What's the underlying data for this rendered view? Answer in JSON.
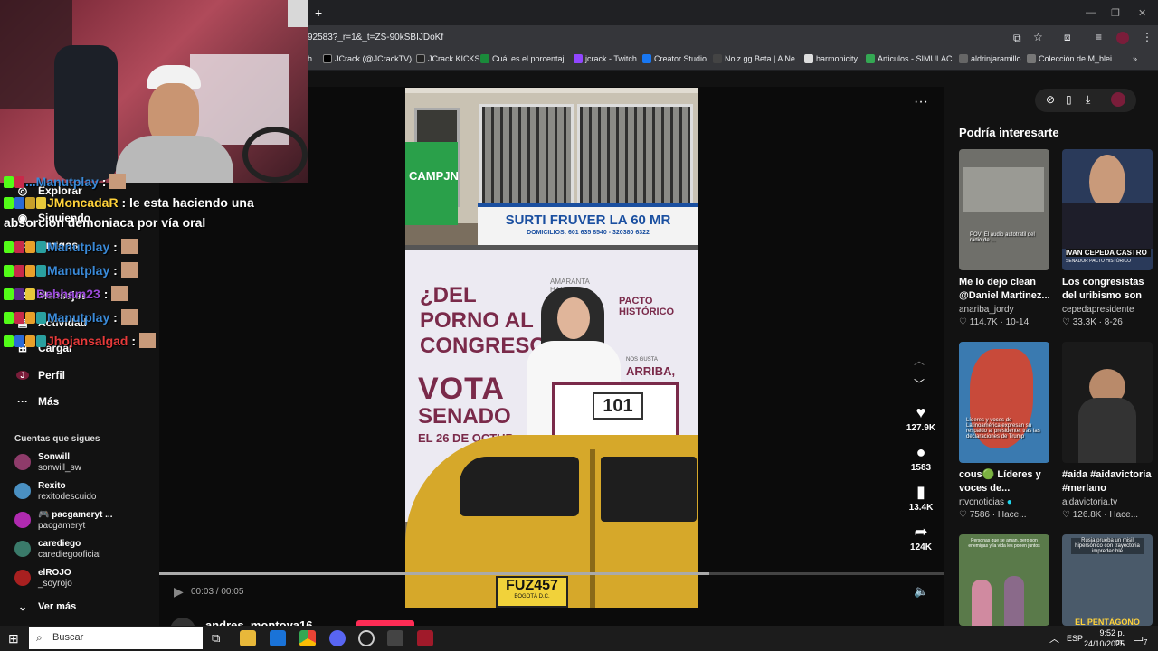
{
  "browser": {
    "url": "92583?_r=1&_t=ZS-90kSBIJDoKf",
    "new_tab": "+",
    "bookmarks": [
      "JCrack (@JCrackTV)...",
      "JCrack KICKS",
      "Cuál es el porcentaj...",
      "jcrack - Twitch",
      "Creator Studio",
      "Noiz.gg Beta | A Ne...",
      "harmonicity",
      "Articulos - SIMULAC...",
      "aldrinjaramillo",
      "Colección de M_blei..."
    ],
    "bookmark_colors": [
      "#000000",
      "#222222",
      "#1a8a3a",
      "#9146ff",
      "#1877f2",
      "#444444",
      "#555555",
      "#34a853",
      "#666666",
      "#777777"
    ]
  },
  "sidebar": {
    "nav": [
      {
        "label": "Explorar",
        "icon": "compass-icon"
      },
      {
        "label": "Siguiendo",
        "icon": "following-icon"
      },
      {
        "label": "Amigos",
        "icon": "friends-icon"
      },
      {
        "label": "Mensajes",
        "icon": "messages-icon"
      },
      {
        "label": "Actividad",
        "icon": "activity-icon"
      },
      {
        "label": "Cargar",
        "icon": "upload-icon"
      },
      {
        "label": "Perfil",
        "icon": "profile-icon"
      },
      {
        "label": "Más",
        "icon": "more-icon"
      }
    ],
    "following_title": "Cuentas que sigues",
    "following": [
      {
        "name": "Sonwill",
        "user": "sonwill_sw",
        "color": "#8e3b6a"
      },
      {
        "name": "Rexito",
        "user": "rexitodescuido",
        "color": "#4a90c2"
      },
      {
        "name": "pacgameryt ...",
        "user": "pacgameryt",
        "color": "#b02ab0"
      },
      {
        "name": "carediego",
        "user": "carediegooficial",
        "color": "#3a7a6a"
      },
      {
        "name": "elROJO",
        "user": "_soyrojo",
        "color": "#a82020"
      }
    ],
    "see_more": "Ver más"
  },
  "player": {
    "time": "00:03 / 00:05",
    "progress": 0.7,
    "author": "andres_montoya16",
    "video_text": {
      "shop_sign": "SURTI FRUVER LA 60 MR",
      "shop_phone": "DOMICILIOS: 601 635 8540 - 320380 6322",
      "poster_headline": "¿DEL PORNO AL CONGRESO?",
      "poster_name": "AMARANTA HANK",
      "party": "PACTO HISTÓRICO",
      "vote": "VOTA",
      "senate": "SENADO",
      "date": "EL 26 DE OCTUB",
      "arriba": "ARRIBA,",
      "nos_gusta": "NOS GUSTA",
      "number": "101",
      "plate": "FUZ457",
      "plate_city": "BOGOTÁ D.C.",
      "campana": "CAMPJN"
    },
    "actions": [
      {
        "icon": "heart-icon",
        "count": "127.9K"
      },
      {
        "icon": "comment-icon",
        "count": "1583"
      },
      {
        "icon": "bookmark-icon",
        "count": "13.4K"
      },
      {
        "icon": "share-icon",
        "count": "124K"
      }
    ]
  },
  "recommendations": {
    "title": "Podría interesarte",
    "items": [
      {
        "title": "Me lo dejo clean @Daniel Martinez...",
        "user": "anariba_jordy",
        "likes": "114.7K",
        "date": "10-14",
        "thumb_text": "POV: El audio autotratil del radio de ...",
        "bg": "#6f6f6a"
      },
      {
        "title": "Los congresistas del uribismo son unos...",
        "user": "cepedapresidente",
        "likes": "33.3K",
        "date": "8-26",
        "thumb_text": "IVAN CEPEDA CASTRO",
        "thumb_sub": "SENADOR PACTO HISTÓRICO",
        "bg": "#2a3a5a"
      },
      {
        "title": "cous🟢 Líderes y voces de...",
        "user": "rtvcnoticias",
        "likes": "7586",
        "date": "Hace...",
        "thumb_text": "Líderes y voces de Latinoamérica expresan su respaldo al presidente, tras las declaraciones de Trump",
        "bg": "#3a7ab0"
      },
      {
        "title": "#aida #aidavictoria #merlano",
        "user": "aidavictoria.tv",
        "likes": "126.8K",
        "date": "Hace...",
        "thumb_text": "",
        "bg": "#1a1a1a"
      },
      {
        "title": "",
        "user": "",
        "likes": "",
        "date": "",
        "thumb_text": "Personas que se aman, pero son enemigas y la vida les ponen juntos",
        "bg": "#5a7a4a"
      },
      {
        "title": "",
        "user": "",
        "likes": "",
        "date": "",
        "thumb_text": "EL PENTÁGONO",
        "thumb_sub": "Rusia prueba un misil hipersónico con trayectoria impredecible",
        "bg": "#4a5a6a"
      }
    ]
  },
  "chat": {
    "lines": [
      {
        "user": "...Manutplay",
        "msg": ":",
        "color": "#3a8ad8"
      },
      {
        "user": "JMoncadaR",
        "msg": ": le esta haciendo una",
        "color": "#ffd23a"
      },
      {
        "user": "",
        "msg": "absorcion demoniaca por vía oral",
        "color": "#fff"
      },
      {
        "user": "Manutplay",
        "msg": ":",
        "color": "#3a8ad8"
      },
      {
        "user": "Manutplay",
        "msg": ":",
        "color": "#3a8ad8"
      },
      {
        "user": "Bebham23",
        "msg": ":",
        "color": "#9a4ad8"
      },
      {
        "user": "Manutplay",
        "msg": ":",
        "color": "#3a8ad8"
      },
      {
        "user": "Jhojansalgad",
        "msg": ":",
        "color": "#e83a3a"
      }
    ]
  },
  "taskbar": {
    "search_placeholder": "Buscar",
    "language": "ESP",
    "time": "9:52 p. m.",
    "date": "24/10/2025",
    "notifications": "7"
  }
}
